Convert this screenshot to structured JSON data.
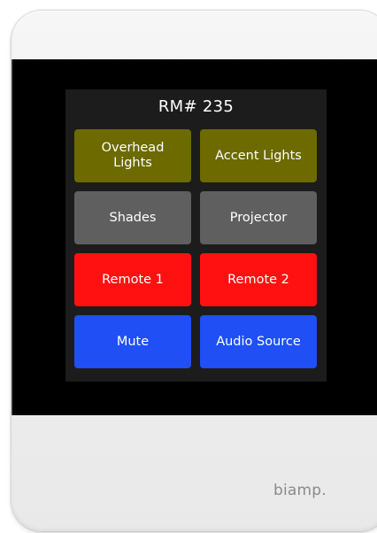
{
  "panel": {
    "room_title": "RM# 235",
    "buttons": [
      {
        "label": "Overhead\nLights",
        "color": "#6d6a00"
      },
      {
        "label": "Accent Lights",
        "color": "#6d6a00"
      },
      {
        "label": "Shades",
        "color": "#5f5f5f"
      },
      {
        "label": "Projector",
        "color": "#5f5f5f"
      },
      {
        "label": "Remote 1",
        "color": "#ff1111"
      },
      {
        "label": "Remote 2",
        "color": "#ff1111"
      },
      {
        "label": "Mute",
        "color": "#1f4ff5"
      },
      {
        "label": "Audio Source",
        "color": "#1f4ff5"
      }
    ]
  },
  "device": {
    "brand_logo": "biamp."
  }
}
